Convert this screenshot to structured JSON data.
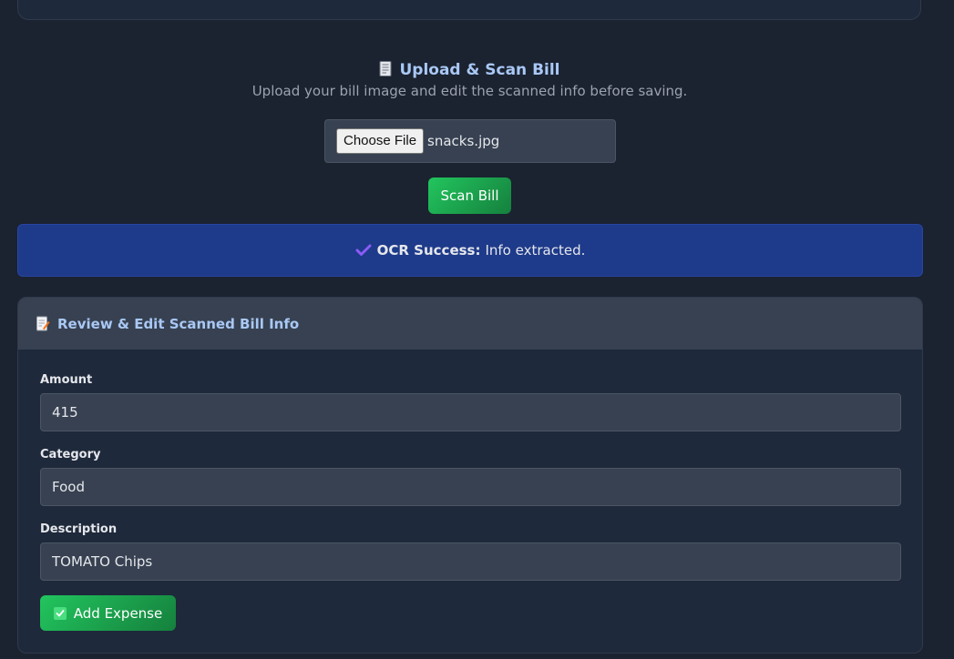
{
  "upload": {
    "title": "Upload & Scan Bill",
    "subtitle": "Upload your bill image and edit the scanned info before saving.",
    "choose_file_label": "Choose File",
    "file_name": "snacks.jpg",
    "scan_button": "Scan Bill",
    "icon": "receipt-icon"
  },
  "ocr": {
    "label": "OCR Success:",
    "message": "Info extracted.",
    "icon": "checkmark-icon",
    "accent": "#8b5cf6"
  },
  "review": {
    "title": "Review & Edit Scanned Bill Info",
    "icon": "memo-icon",
    "fields": [
      {
        "label": "Amount",
        "value": "415"
      },
      {
        "label": "Category",
        "value": "Food"
      },
      {
        "label": "Description",
        "value": "TOMATO Chips"
      }
    ],
    "submit_label": "Add Expense",
    "submit_icon": "check-box-icon"
  },
  "colors": {
    "background": "#1b2230",
    "card": "#1e293b",
    "banner": "#1e3a8a",
    "accent_green": "#22c55e",
    "heading_blue": "#a9c8f5"
  }
}
